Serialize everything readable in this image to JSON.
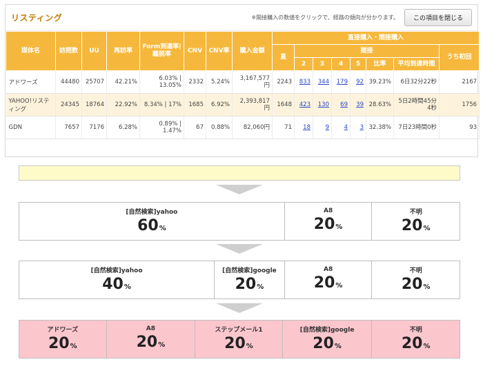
{
  "panel": {
    "title": "リスティング",
    "note": "※間接購入の数値をクリックで、経路の傾向が分かります。",
    "close_label": "この項目を閉じる"
  },
  "table": {
    "headers": {
      "media": "媒体名",
      "visits": "訪問数",
      "uu": "UU",
      "revisit": "再訪率",
      "form": "Form到達率|離脱率",
      "cnv": "CNV",
      "cnv_rate": "CNV率",
      "amount": "購入金額",
      "group": "直接購入・間接購入",
      "direct": "直",
      "indirect": "間接",
      "n2": "2",
      "n3": "3",
      "n4": "4",
      "n5": "5",
      "ratio": "比率",
      "avg_time": "平均到達時間",
      "first": "うち初回"
    },
    "rows": [
      {
        "name": "アドワーズ",
        "visits": "44480",
        "uu": "25707",
        "revisit": "42.21%",
        "form": "6.03% | 13.05%",
        "cnv": "2332",
        "cnv_rate": "5.24%",
        "amount": "3,167,577円",
        "direct": "2243",
        "n2": "833",
        "n3": "344",
        "n4": "179",
        "n5": "92",
        "ratio": "39.23%",
        "avg_time": "6日32分22秒",
        "first": "2167"
      },
      {
        "name": "YAHOO!リスティング",
        "visits": "24345",
        "uu": "18764",
        "revisit": "22.92%",
        "form": "8.34% | 17%",
        "cnv": "1685",
        "cnv_rate": "6.92%",
        "amount": "2,393,817円",
        "direct": "1648",
        "n2": "423",
        "n3": "130",
        "n4": "69",
        "n5": "39",
        "ratio": "28.63%",
        "avg_time": "5日2時間45分4秒",
        "first": "1756"
      },
      {
        "name": "GDN",
        "visits": "7657",
        "uu": "7176",
        "revisit": "6.28%",
        "form": "0.89% | 1.47%",
        "cnv": "67",
        "cnv_rate": "0.88%",
        "amount": "82,060円",
        "direct": "71",
        "n2": "18",
        "n3": "9",
        "n4": "4",
        "n5": "3",
        "ratio": "32.38%",
        "avg_time": "7日23時間0秒",
        "first": "93"
      }
    ]
  },
  "flow": {
    "unit": "%",
    "rows": [
      {
        "cells": [
          {
            "label": "[自然検索]yahoo",
            "value": "60"
          },
          {
            "label": "A8",
            "value": "20"
          },
          {
            "label": "不明",
            "value": "20"
          }
        ]
      },
      {
        "cells": [
          {
            "label": "[自然検索]yahoo",
            "value": "40"
          },
          {
            "label": "[自然検索]google",
            "value": "20"
          },
          {
            "label": "A8",
            "value": "20"
          },
          {
            "label": "不明",
            "value": "20"
          }
        ]
      },
      {
        "cells": [
          {
            "label": "アドワーズ",
            "value": "20"
          },
          {
            "label": "A8",
            "value": "20"
          },
          {
            "label": "ステップメール1",
            "value": "20"
          },
          {
            "label": "[自然検索]google",
            "value": "20"
          },
          {
            "label": "不明",
            "value": "20"
          }
        ]
      }
    ]
  },
  "colors": {
    "header_orange": "#f6b83c",
    "title_orange": "#c07a00",
    "alt_row": "#fdf3dc",
    "note_bar": "#fffbc9",
    "pink_row": "#fcc6cd",
    "link_blue": "#2a45c9"
  }
}
